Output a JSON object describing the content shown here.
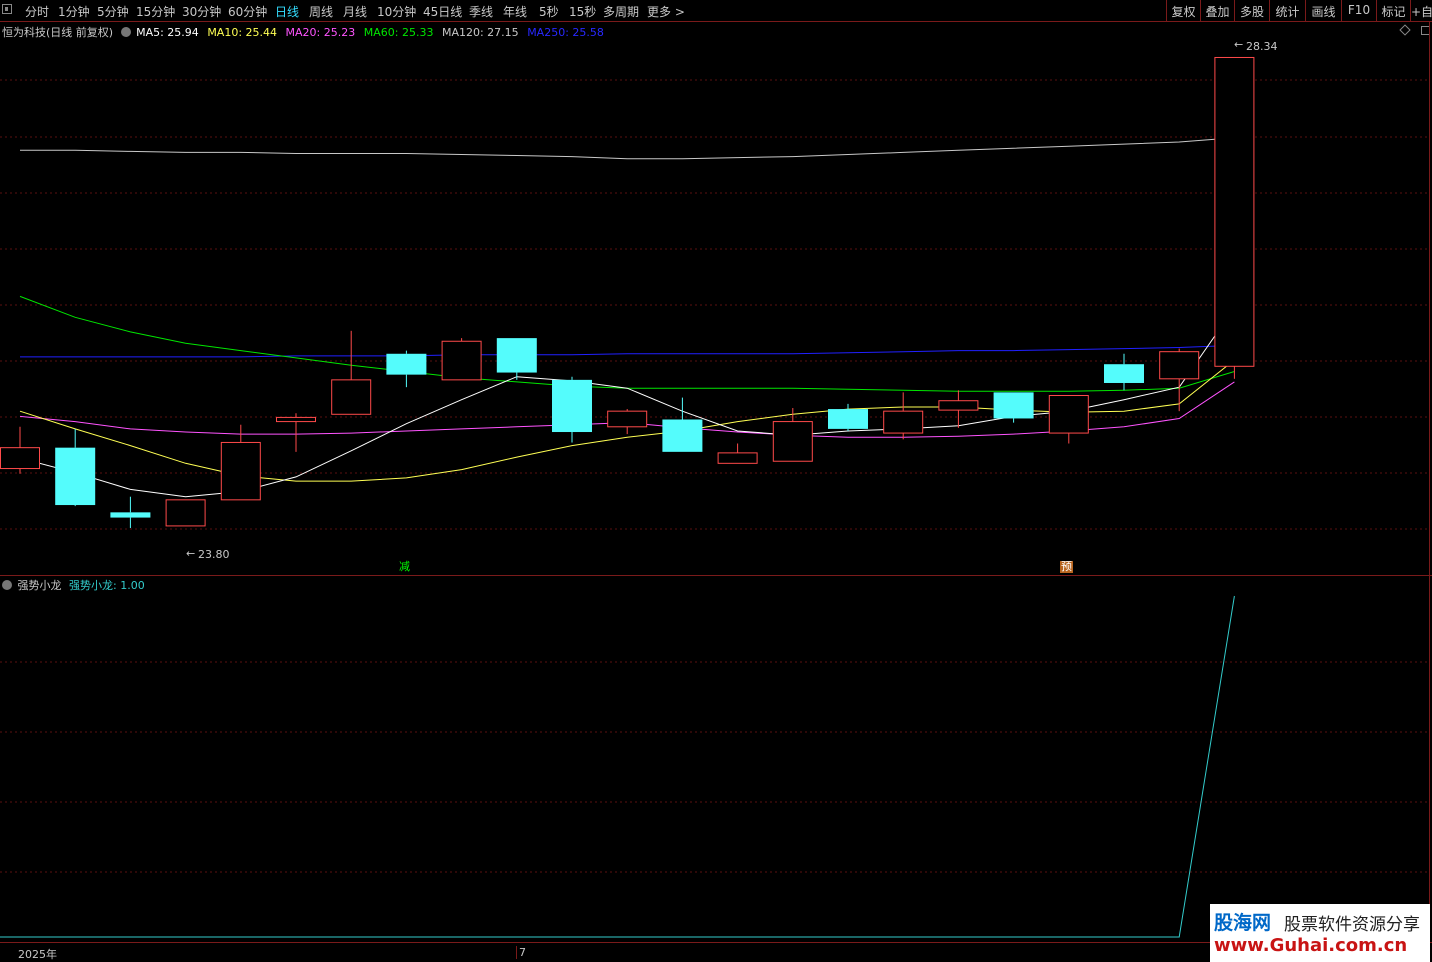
{
  "toolbar": {
    "periods": [
      "分时",
      "1分钟",
      "5分钟",
      "15分钟",
      "30分钟",
      "60分钟",
      "日线",
      "周线",
      "月线",
      "10分钟",
      "45日线",
      "季线",
      "年线",
      "5秒",
      "15秒",
      "多周期",
      "更多 >"
    ],
    "active": "日线",
    "right": [
      "复权",
      "叠加",
      "多股",
      "统计",
      "画线",
      "F10",
      "标记",
      "+自"
    ]
  },
  "legend": {
    "title": "恒为科技(日线 前复权)",
    "ma5": "MA5: 25.94",
    "ma10": "MA10: 25.44",
    "ma20": "MA20: 25.23",
    "ma60": "MA60: 25.33",
    "ma120": "MA120: 27.15",
    "ma250": "MA250: 25.58"
  },
  "colors": {
    "up": "#ff4a4a",
    "down": "#54fcfc",
    "ma5": "#ffffff",
    "ma10": "#ffff54",
    "ma20": "#ff54ff",
    "ma60": "#00e600",
    "ma120": "#c8c8c8",
    "ma250": "#2020ff",
    "indicator": "#33cccc"
  },
  "annotations": {
    "high_label": "28.34",
    "low_label": "23.80",
    "badge_reduce": "减",
    "badge_pre": "预"
  },
  "indicator": {
    "title": "强势小龙",
    "value_label": "强势小龙: 1.00"
  },
  "axis": {
    "year_label": "2025年",
    "month_label": "7"
  },
  "watermark": {
    "brand": "股海网",
    "tagline": "股票软件资源分享",
    "url": "www.Guhai.com.cn"
  },
  "chart_data": {
    "type": "candlestick",
    "price_range": [
      23.6,
      28.45
    ],
    "candles": [
      {
        "o": 24.4,
        "c": 24.6,
        "h": 24.8,
        "l": 24.35
      },
      {
        "o": 24.6,
        "c": 24.05,
        "h": 24.78,
        "l": 24.04
      },
      {
        "o": 23.98,
        "c": 23.93,
        "h": 24.13,
        "l": 23.83
      },
      {
        "o": 23.85,
        "c": 24.1,
        "h": 24.1,
        "l": 23.85
      },
      {
        "o": 24.1,
        "c": 24.65,
        "h": 24.82,
        "l": 24.1
      },
      {
        "o": 24.85,
        "c": 24.89,
        "h": 24.93,
        "l": 24.56
      },
      {
        "o": 24.92,
        "c": 25.25,
        "h": 25.72,
        "l": 24.92
      },
      {
        "o": 25.5,
        "c": 25.3,
        "h": 25.53,
        "l": 25.18
      },
      {
        "o": 25.25,
        "c": 25.62,
        "h": 25.65,
        "l": 25.25
      },
      {
        "o": 25.65,
        "c": 25.32,
        "h": 25.65,
        "l": 25.25
      },
      {
        "o": 25.25,
        "c": 24.75,
        "h": 25.28,
        "l": 24.65
      },
      {
        "o": 24.8,
        "c": 24.95,
        "h": 24.97,
        "l": 24.73
      },
      {
        "o": 24.87,
        "c": 24.56,
        "h": 25.08,
        "l": 24.56
      },
      {
        "o": 24.45,
        "c": 24.55,
        "h": 24.64,
        "l": 24.45
      },
      {
        "o": 24.47,
        "c": 24.85,
        "h": 24.98,
        "l": 24.47
      },
      {
        "o": 24.97,
        "c": 24.78,
        "h": 25.02,
        "l": 24.76
      },
      {
        "o": 24.74,
        "c": 24.95,
        "h": 25.13,
        "l": 24.68
      },
      {
        "o": 24.96,
        "c": 25.05,
        "h": 25.15,
        "l": 24.79
      },
      {
        "o": 25.13,
        "c": 24.88,
        "h": 25.13,
        "l": 24.84
      },
      {
        "o": 24.74,
        "c": 25.1,
        "h": 25.1,
        "l": 24.64
      },
      {
        "o": 25.4,
        "c": 25.22,
        "h": 25.5,
        "l": 25.15
      },
      {
        "o": 25.26,
        "c": 25.52,
        "h": 25.55,
        "l": 24.95
      },
      {
        "o": 25.38,
        "c": 28.34,
        "h": 28.34,
        "l": 25.26
      }
    ],
    "ma5": [
      24.5,
      24.36,
      24.2,
      24.13,
      24.18,
      24.32,
      24.57,
      24.83,
      25.06,
      25.28,
      25.24,
      25.17,
      24.95,
      24.76,
      24.72,
      24.76,
      24.78,
      24.81,
      24.9,
      24.95,
      25.06,
      25.18,
      25.94
    ],
    "ma10": [
      24.95,
      24.78,
      24.62,
      24.45,
      24.33,
      24.28,
      24.28,
      24.31,
      24.39,
      24.51,
      24.62,
      24.7,
      24.76,
      24.85,
      24.92,
      24.97,
      24.99,
      24.99,
      24.96,
      24.94,
      24.95,
      25.02,
      25.44
    ],
    "ma20": [
      24.9,
      24.85,
      24.78,
      24.75,
      24.73,
      24.73,
      24.74,
      24.76,
      24.78,
      24.8,
      24.82,
      24.84,
      24.79,
      24.75,
      24.72,
      24.7,
      24.7,
      24.71,
      24.73,
      24.76,
      24.8,
      24.88,
      25.23
    ],
    "ma60": [
      26.05,
      25.85,
      25.71,
      25.6,
      25.53,
      25.46,
      25.39,
      25.33,
      25.27,
      25.23,
      25.19,
      25.17,
      25.17,
      25.17,
      25.17,
      25.16,
      25.15,
      25.14,
      25.14,
      25.14,
      25.15,
      25.17,
      25.33
    ],
    "ma120": [
      27.45,
      27.45,
      27.44,
      27.43,
      27.43,
      27.42,
      27.42,
      27.42,
      27.41,
      27.4,
      27.39,
      27.37,
      27.37,
      27.38,
      27.39,
      27.41,
      27.43,
      27.45,
      27.47,
      27.49,
      27.51,
      27.53,
      27.57
    ],
    "ma250": [
      25.47,
      25.47,
      25.47,
      25.47,
      25.47,
      25.48,
      25.48,
      25.48,
      25.49,
      25.49,
      25.49,
      25.5,
      25.5,
      25.5,
      25.5,
      25.51,
      25.52,
      25.53,
      25.53,
      25.54,
      25.55,
      25.56,
      25.58
    ],
    "indicator": {
      "range": [
        0,
        1
      ],
      "values": [
        0,
        0,
        0,
        0,
        0,
        0,
        0,
        0,
        0,
        0,
        0,
        0,
        0,
        0,
        0,
        0,
        0,
        0,
        0,
        0,
        0,
        0,
        1
      ]
    }
  }
}
